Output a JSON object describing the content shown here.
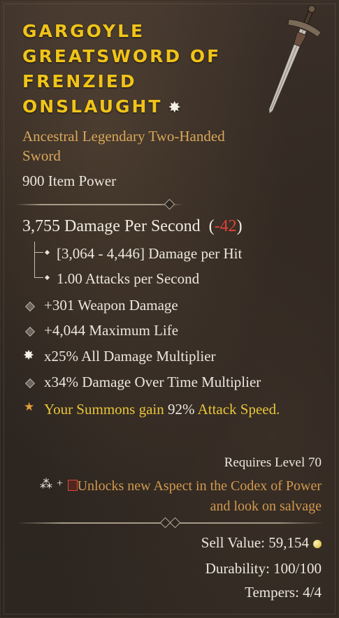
{
  "item": {
    "name_lines": [
      "Gargoyle",
      "Greatsword of",
      "Frenzied",
      "Onslaught"
    ],
    "legendary_marker": "✸",
    "type_line": "Ancestral Legendary Two-Handed Sword",
    "item_power": "900 Item Power",
    "dps": {
      "value_text": "3,755 Damage Per Second",
      "open": "(",
      "delta": "-42",
      "close": ")"
    },
    "damage_per_hit": "[3,064 - 4,446] Damage per Hit",
    "attacks_per_second": "1.00 Attacks per Second",
    "affixes": [
      "+301 Weapon Damage",
      "+4,044 Maximum Life",
      "x25% All Damage Multiplier",
      "x34% Damage Over Time Multiplier"
    ],
    "legendary_power": {
      "part1": "Your Summons gain",
      "value": "92%",
      "part2": "Attack Speed."
    },
    "requires_level": "Requires Level 70",
    "unlock_text": "Unlocks new Aspect in the Codex of Power and look on salvage",
    "sell_value": "Sell Value: 59,154",
    "durability": "Durability: 100/100",
    "tempers": "Tempers: 4/4"
  },
  "icons": {
    "title_marker": "burst-icon",
    "affix_bullet": "diamond-icon",
    "greater_affix": "burst-icon",
    "legendary_bullet": "star-icon",
    "codex_icons": [
      "rune-icon",
      "plus-icon",
      "red-rune-icon"
    ],
    "gold": "gold-coin-icon"
  },
  "colors": {
    "title": "#f0c419",
    "type_line": "#d8a85a",
    "negative": "#e0453a",
    "legendary": "#e8c53a",
    "unlock": "#d39a4e"
  }
}
